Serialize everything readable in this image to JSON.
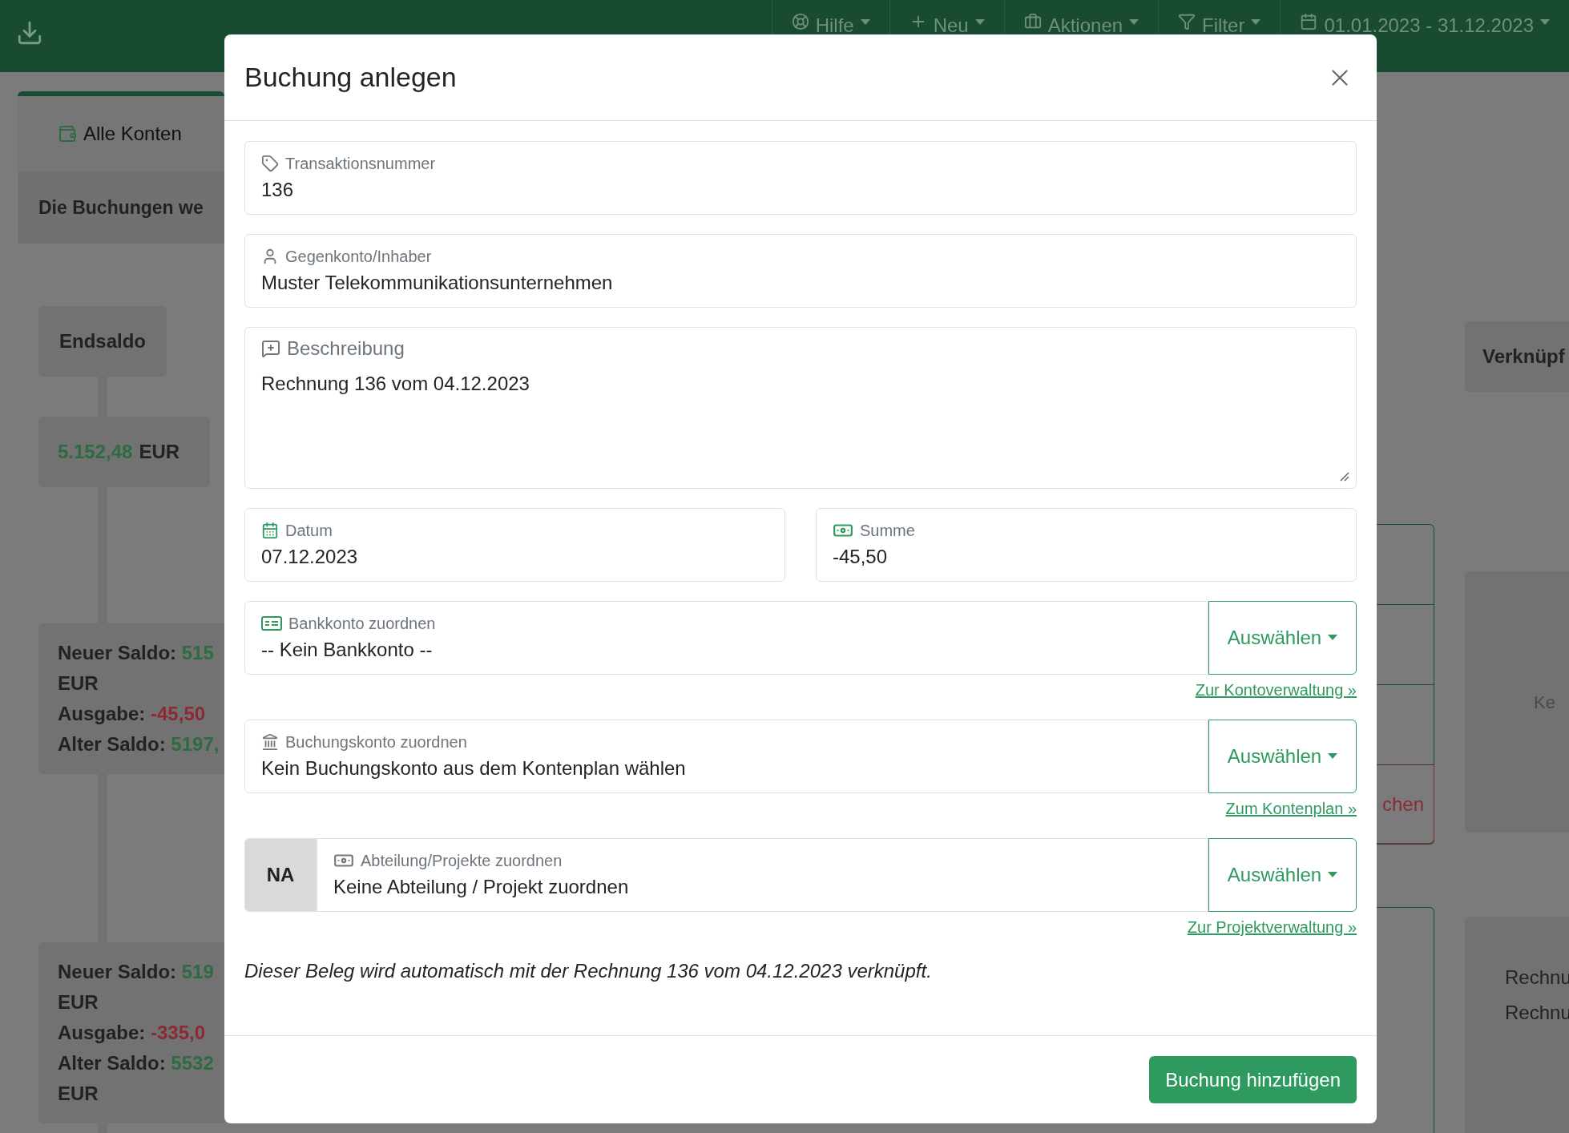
{
  "topbar": {
    "nav": [
      {
        "label": "Hilfe"
      },
      {
        "label": "Neu"
      },
      {
        "label": "Aktionen"
      },
      {
        "label": "Filter"
      },
      {
        "label": "01.01.2023 - 31.12.2023"
      }
    ]
  },
  "background": {
    "tab": "Alle Konten",
    "notice": "Die Buchungen we",
    "timeline_title": "Endsaldo",
    "final_balance": {
      "amount": "5.152,48",
      "unit": "EUR"
    },
    "entries": [
      {
        "lines": [
          {
            "label": "Neuer Saldo:",
            "amount": "515",
            "color": "#2e6b43"
          },
          {
            "label": "EUR"
          },
          {
            "label": "Ausgabe:",
            "amount": "-45,50",
            "color": "#8b2a35"
          },
          {
            "label": "Alter Saldo:",
            "amount": "5197,",
            "color": "#2e6b43"
          }
        ]
      },
      {
        "lines": [
          {
            "label": "Neuer Saldo:",
            "amount": "519",
            "color": "#2e6b43"
          },
          {
            "label": "EUR"
          },
          {
            "label": "Ausgabe:",
            "amount": "-335,0",
            "color": "#8b2a35"
          },
          {
            "label": "Alter Saldo:",
            "amount": "5532",
            "color": "#2e6b43"
          },
          {
            "label": "EUR"
          }
        ]
      }
    ],
    "middle_action": "chen",
    "right_title": "Verknüpf",
    "right_hint": "Ke",
    "right_lines": [
      "Rechnu",
      "Rechnu"
    ]
  },
  "modal": {
    "title": "Buchung anlegen",
    "fields": [
      {
        "label": "Transaktionsnummer",
        "value": "136"
      },
      {
        "label": "Gegenkonto/Inhaber",
        "value": "Muster Telekommunikationsunternehmen"
      },
      {
        "label": "Beschreibung",
        "value": "Rechnung 136 vom 04.12.2023",
        "kind": "textarea"
      }
    ],
    "pair": [
      {
        "label": "Datum",
        "value": "07.12.2023"
      },
      {
        "label": "Summe",
        "value": "-45,50"
      }
    ],
    "selects": [
      {
        "label": "Bankkonto zuordnen",
        "value": "-- Kein Bankkonto --",
        "button": "Auswählen",
        "link": "Zur Kontoverwaltung »"
      },
      {
        "label": "Buchungskonto zuordnen",
        "value": "Kein Buchungskonto aus dem Kontenplan wählen",
        "button": "Auswählen",
        "link": "Zum Kontenplan »"
      },
      {
        "prefix": "NA",
        "label": "Abteilung/Projekte zuordnen",
        "value": "Keine Abteilung / Projekt zuordnen",
        "button": "Auswählen",
        "link": "Zur Projektverwaltung »"
      }
    ],
    "note": "Dieser Beleg wird automatisch mit der Rechnung 136 vom 04.12.2023 verknüpft.",
    "submit": "Buchung hinzufügen"
  }
}
